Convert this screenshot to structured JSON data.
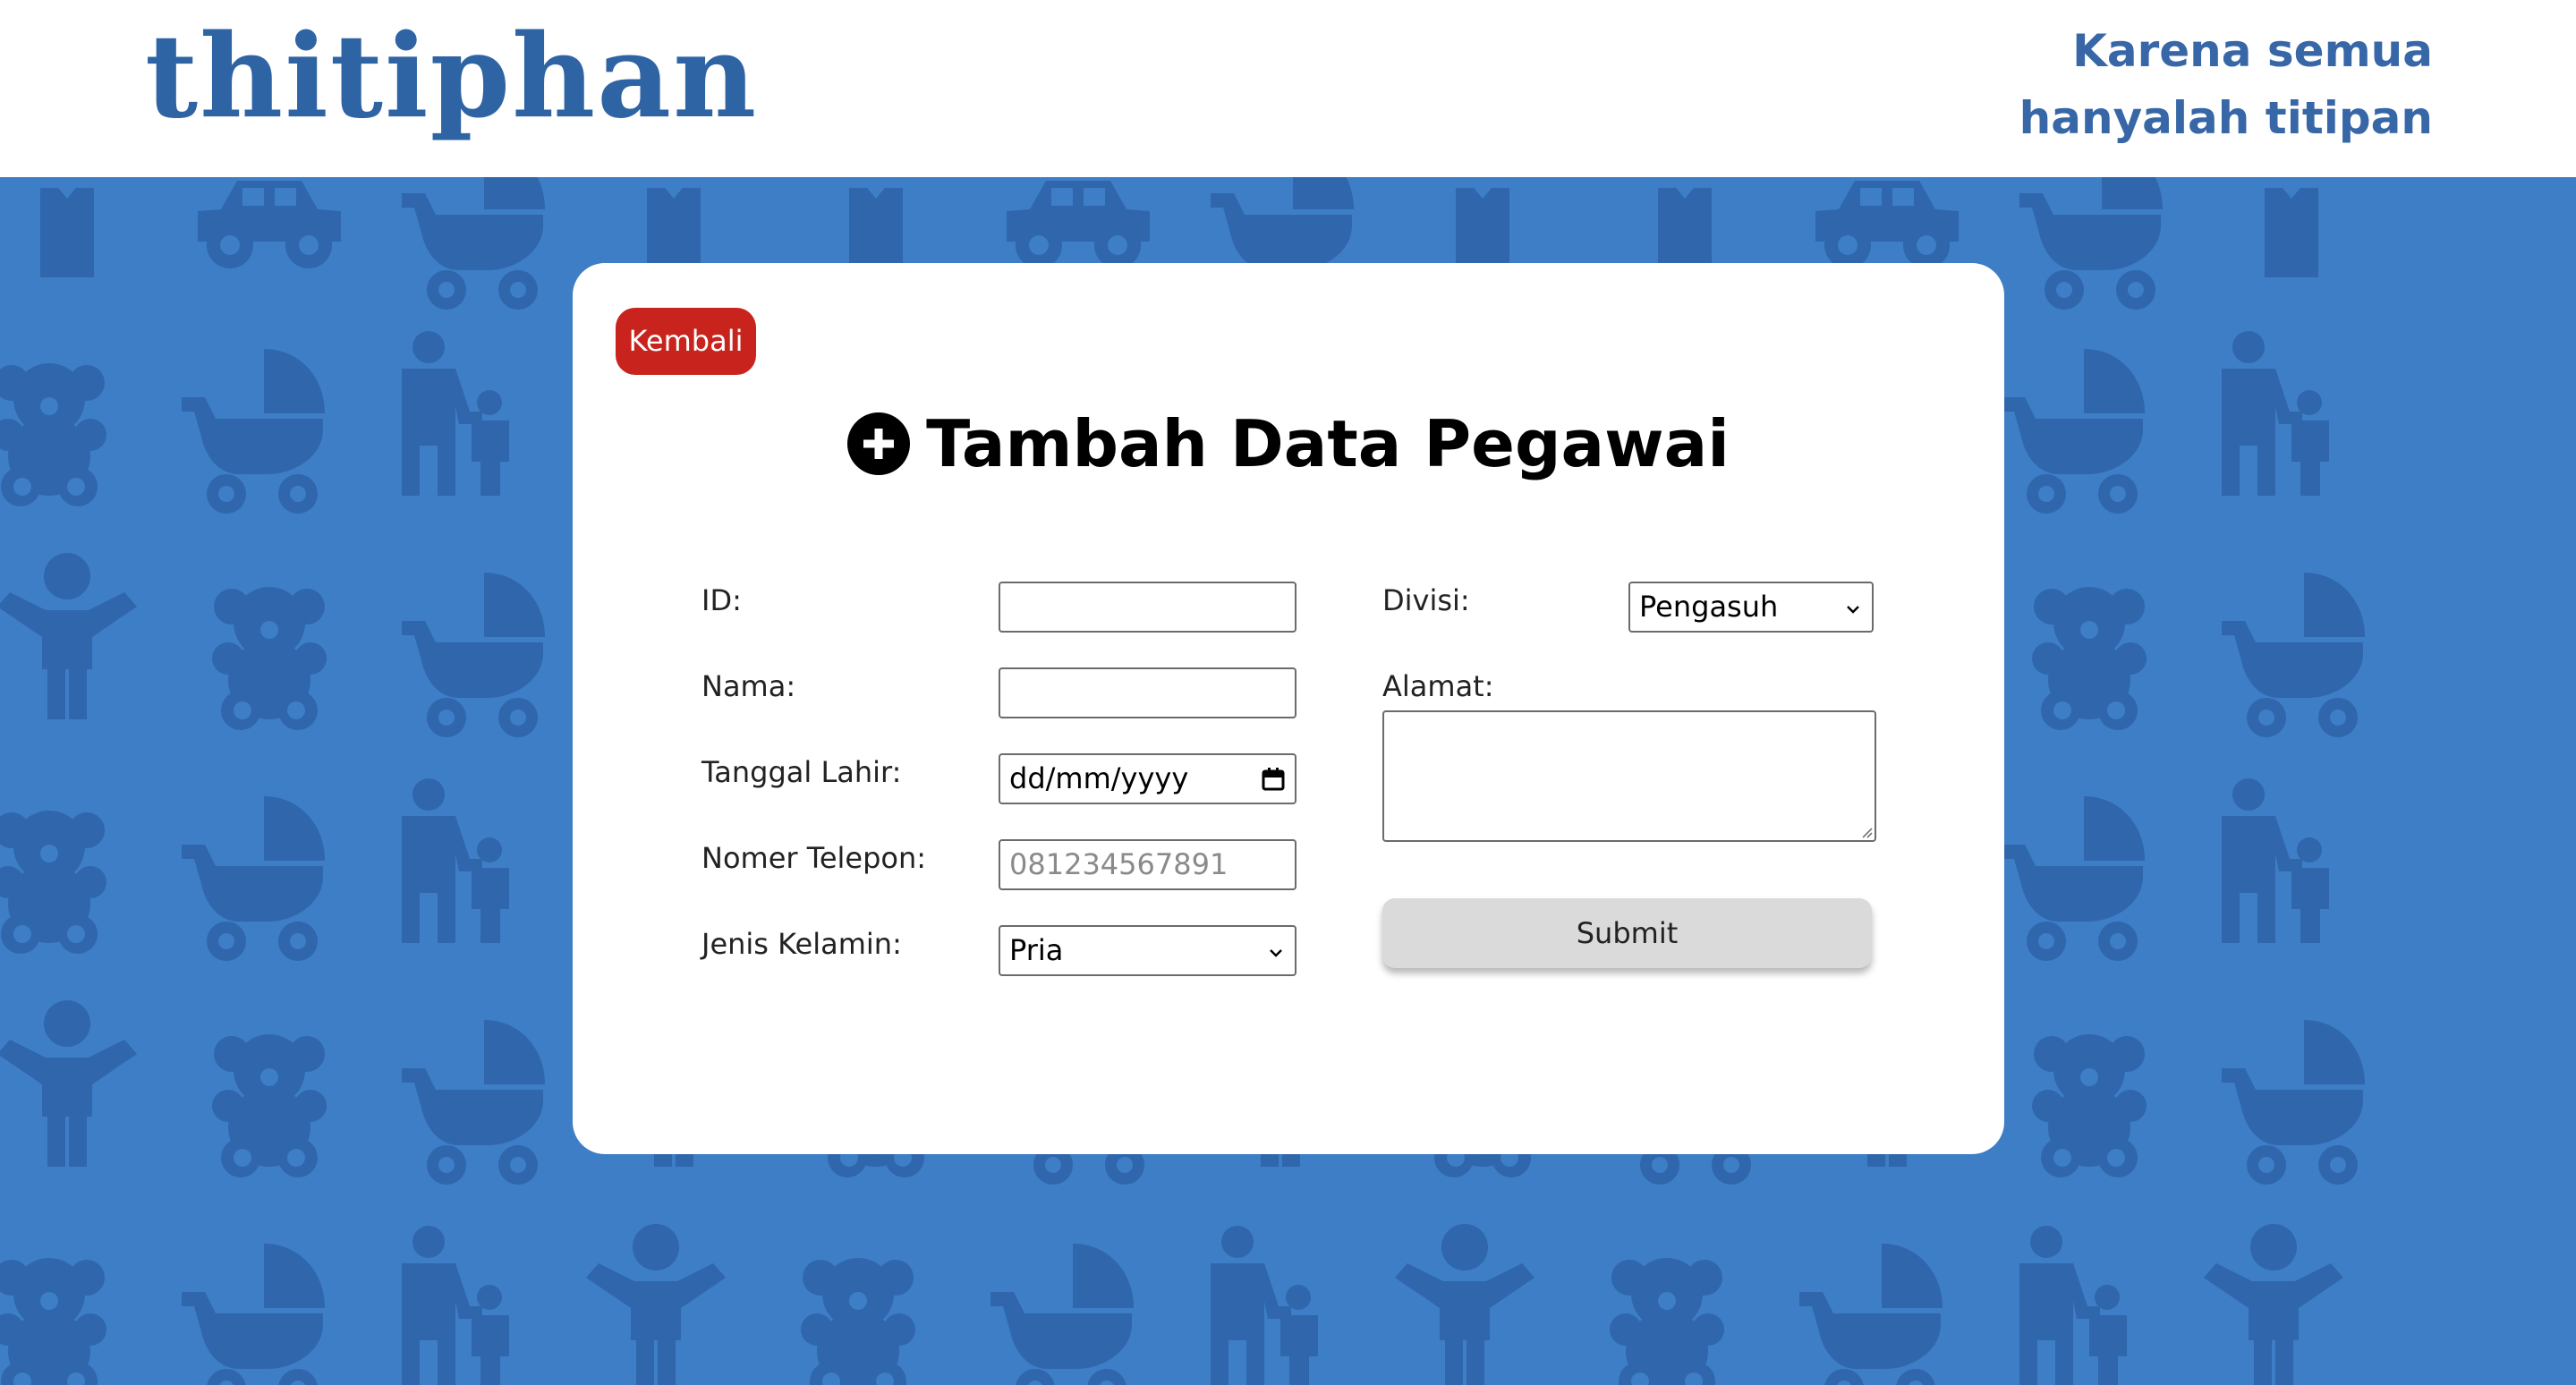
{
  "header": {
    "logo_text": "thitiphan",
    "tagline_line1": "Karena semua",
    "tagline_line2": "hanyalah titipan"
  },
  "card": {
    "back_label": "Kembali",
    "title": "Tambah Data Pegawai",
    "title_icon": "plus-circle-icon"
  },
  "form": {
    "id": {
      "label": "ID:",
      "value": ""
    },
    "nama": {
      "label": "Nama:",
      "value": ""
    },
    "tanggal_lahir": {
      "label": "Tanggal Lahir:",
      "value": "dd/mm/yyyy"
    },
    "nomer_telepon": {
      "label": "Nomer Telepon:",
      "placeholder": "081234567891"
    },
    "jenis_kelamin": {
      "label": "Jenis Kelamin:",
      "selected": "Pria"
    },
    "divisi": {
      "label": "Divisi:",
      "selected": "Pengasuh"
    },
    "alamat": {
      "label": "Alamat:",
      "value": ""
    },
    "submit_label": "Submit"
  },
  "colors": {
    "background": "#3d7ec6",
    "pattern": "#2f66ac",
    "brand": "#2f64a4",
    "back_button": "#c8231c",
    "submit_button": "#dadada"
  },
  "background_icons": [
    "teddy-bear-icon",
    "stroller-icon",
    "parent-child-icon",
    "child-icon",
    "toy-car-icon",
    "shirt-icon"
  ]
}
